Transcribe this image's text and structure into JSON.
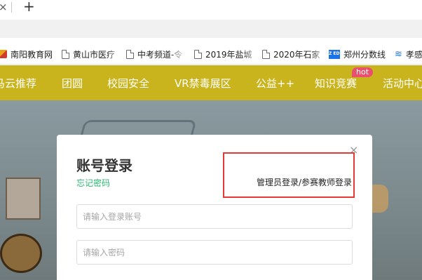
{
  "browser": {
    "tab_close_glyph": "×",
    "new_tab_glyph": "+",
    "bookmarks": [
      {
        "label": "南阳教育网",
        "icon": "nanyang-logo-icon"
      },
      {
        "label": "黄山市医疗",
        "icon": "page-icon"
      },
      {
        "label": "中考频道-令",
        "icon": "page-icon"
      },
      {
        "label": "2019年盐城",
        "icon": "page-icon"
      },
      {
        "label": "2020年石家",
        "icon": "page-icon"
      },
      {
        "label": "郑州分数线",
        "icon": "edu-logo-icon",
        "icon_text": "ZZ EDU"
      },
      {
        "label": "孝感",
        "icon": "wave-icon"
      }
    ]
  },
  "site_nav": {
    "items": [
      "马云推荐",
      "团圆",
      "校园安全",
      "VR禁毒展区",
      "公益++",
      "知识竞赛",
      "活动中心"
    ],
    "hot_badge": "hot"
  },
  "login_modal": {
    "close_glyph": "×",
    "title": "账号登录",
    "forgot_password": "忘记密码",
    "admin_login": "管理员登录/参赛教师登录",
    "account_placeholder": "请输入登录账号",
    "password_placeholder": "请输入密码"
  },
  "colors": {
    "nav_bar": "#c9b41d",
    "forgot_link": "#2bb673",
    "highlight": "#e53935",
    "hot_badge": "#e8506e"
  }
}
